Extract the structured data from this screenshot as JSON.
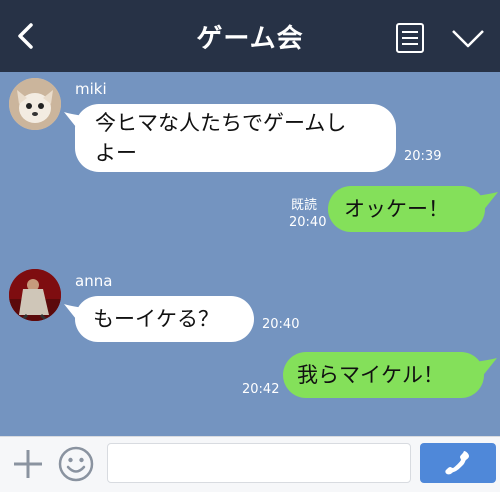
{
  "header": {
    "title": "ゲーム会",
    "icons": [
      "back-chevron-icon",
      "menu-icon",
      "chevron-down-icon"
    ]
  },
  "messages": [
    {
      "sender": "miki",
      "text_line1": "今ヒマな人たちでゲームし",
      "text_line2": "よー",
      "time": "20:39"
    },
    {
      "sender": "me",
      "text": "オッケー！",
      "read": "既読",
      "time": "20:40"
    },
    {
      "sender": "anna",
      "text": "もーイケる？",
      "time": "20:40"
    },
    {
      "sender": "me",
      "text": "我らマイケル！",
      "time": "20:42"
    }
  ],
  "input": {
    "value": "",
    "placeholder": ""
  },
  "colors": {
    "header_bg": "#273246",
    "chat_bg": "#7494c0",
    "incoming_bubble": "#ffffff",
    "outgoing_bubble": "#84e05a",
    "call_button": "#4f88d9"
  }
}
